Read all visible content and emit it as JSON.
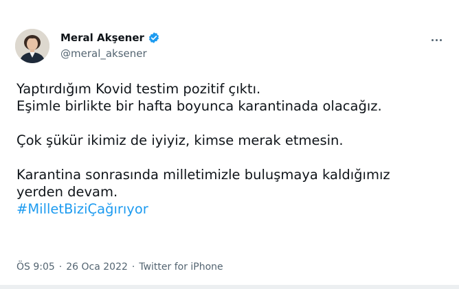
{
  "author": {
    "display_name": "Meral Akşener",
    "handle": "@meral_aksener",
    "verified": true,
    "avatar_icon": "profile-photo"
  },
  "tweet": {
    "lines_paragraph_1": [
      "Yaptırdığım Kovid testim pozitif çıktı.",
      "Eşimle birlikte bir hafta boyunca karantinada olacağız."
    ],
    "paragraph_2": "Çok şükür ikimiz de iyiyiz, kimse merak etmesin.",
    "lines_paragraph_3": [
      "Karantina sonrasında milletimizle buluşmaya kaldığımız",
      "yerden devam."
    ],
    "hashtag": "#MilletBiziÇağırıyor"
  },
  "meta": {
    "time": "ÖS 9:05",
    "date": "26 Oca 2022",
    "source": "Twitter for iPhone",
    "separator": "·"
  },
  "colors": {
    "accent": "#1d9bf0",
    "text": "#0f1419",
    "secondary": "#536471"
  },
  "icons": {
    "verified": "verified-badge-icon",
    "more": "more-options-icon"
  }
}
